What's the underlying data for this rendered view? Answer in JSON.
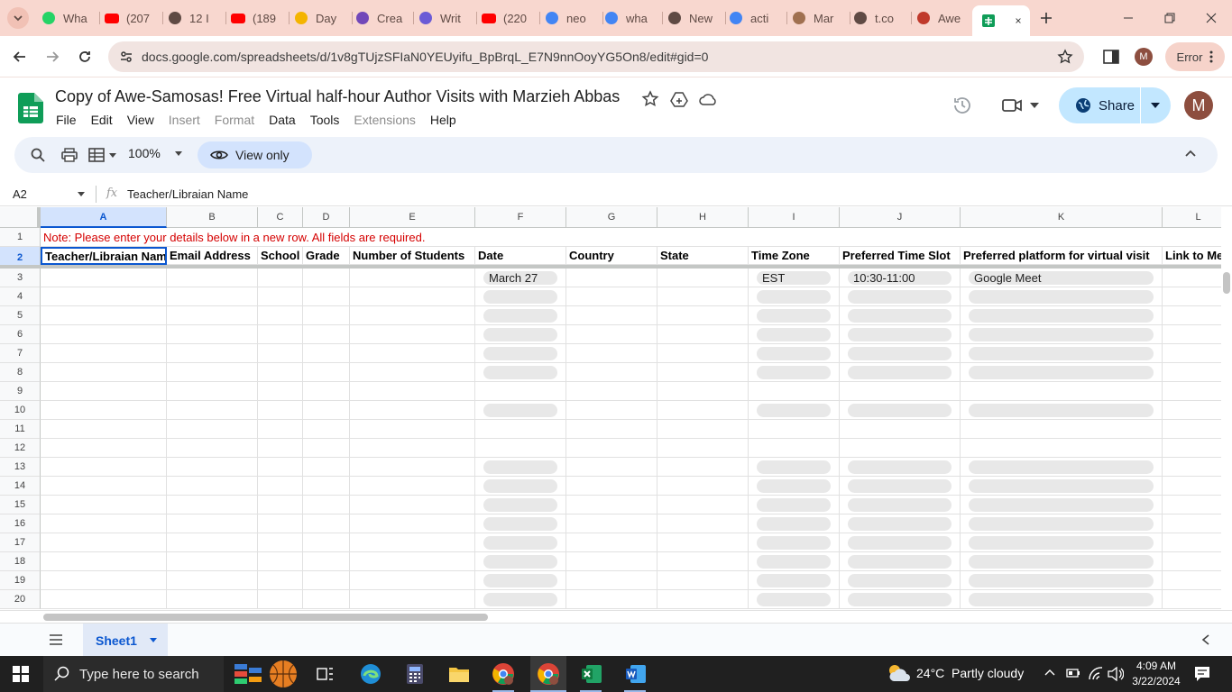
{
  "browser": {
    "tabs": [
      {
        "title": "Wha",
        "icon": "whatsapp-icon"
      },
      {
        "title": "(207",
        "icon": "youtube-icon"
      },
      {
        "title": "12 I",
        "icon": "steam-icon"
      },
      {
        "title": "(189",
        "icon": "youtube-icon"
      },
      {
        "title": "Day",
        "icon": "google-drive-icon"
      },
      {
        "title": "Crea",
        "icon": "forms-icon"
      },
      {
        "title": "Writ",
        "icon": "app-icon"
      },
      {
        "title": "(220",
        "icon": "youtube-icon"
      },
      {
        "title": "neo",
        "icon": "google-icon"
      },
      {
        "title": "wha",
        "icon": "google-icon"
      },
      {
        "title": "New",
        "icon": "github-icon"
      },
      {
        "title": "acti",
        "icon": "google-icon"
      },
      {
        "title": "Mar",
        "icon": "photo-icon"
      },
      {
        "title": "t.co",
        "icon": "globe-icon"
      },
      {
        "title": "Awe",
        "icon": "calendar-icon"
      }
    ],
    "url": "docs.google.com/spreadsheets/d/1v8gTUjzSFIaN0YEUyifu_BpBrqL_E7N9nnOoyYG5On8/edit#gid=0",
    "profile_initial": "M",
    "error_label": "Error"
  },
  "sheets": {
    "title": "Copy of Awe-Samosas! Free Virtual half-hour Author Visits with Marzieh Abbas",
    "menu": [
      {
        "label": "File",
        "disabled": false
      },
      {
        "label": "Edit",
        "disabled": false
      },
      {
        "label": "View",
        "disabled": false
      },
      {
        "label": "Insert",
        "disabled": true
      },
      {
        "label": "Format",
        "disabled": true
      },
      {
        "label": "Data",
        "disabled": false
      },
      {
        "label": "Tools",
        "disabled": false
      },
      {
        "label": "Extensions",
        "disabled": true
      },
      {
        "label": "Help",
        "disabled": false
      }
    ],
    "share_label": "Share",
    "avatar_initial": "M",
    "zoom": "100%",
    "view_only_label": "View only",
    "cell_ref": "A2",
    "formula_content": "Teacher/Libraian Name",
    "fx_label": "fx",
    "sheet_tab": "Sheet1"
  },
  "grid": {
    "columns": [
      "A",
      "B",
      "C",
      "D",
      "E",
      "F",
      "G",
      "H",
      "I",
      "J",
      "K",
      "L"
    ],
    "row_numbers": [
      "1",
      "2",
      "3",
      "4",
      "5",
      "6",
      "7",
      "8",
      "9",
      "10",
      "11",
      "12",
      "13",
      "14",
      "15",
      "16",
      "17",
      "18",
      "19",
      "20"
    ],
    "note": "Note: Please enter your details below in a new row. All fields are required.",
    "headers": [
      "Teacher/Libraian Name",
      "Email Address",
      "School",
      "Grade",
      "Number of Students",
      "Date",
      "Country",
      "State",
      "Time Zone",
      "Preferred Time Slot",
      "Preferred platform for virtual visit",
      "Link to Me"
    ],
    "row3": {
      "date": "March 27",
      "timezone": "EST",
      "timeslot": "10:30-11:00",
      "platform": "Google Meet"
    },
    "chip_rows": [
      "3",
      "4",
      "5",
      "6",
      "7",
      "8",
      "10",
      "13",
      "14",
      "15",
      "16",
      "17",
      "18",
      "19",
      "20"
    ]
  },
  "taskbar": {
    "search_placeholder": "Type here to search",
    "weather": "24°C  Partly cloudy",
    "time": "4:09 AM",
    "date": "3/22/2024"
  }
}
